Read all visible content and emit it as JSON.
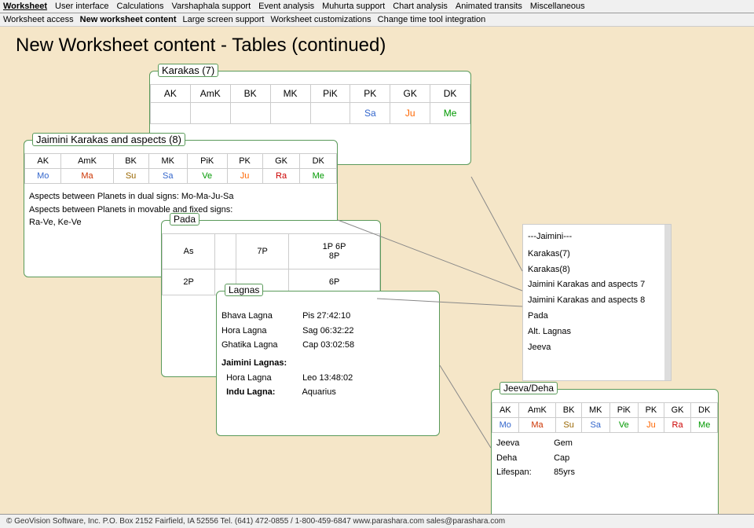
{
  "menu": {
    "items": [
      {
        "label": "Worksheet",
        "active": true
      },
      {
        "label": "User interface"
      },
      {
        "label": "Calculations"
      },
      {
        "label": "Varshaphala support"
      },
      {
        "label": "Event analysis"
      },
      {
        "label": "Muhurta support"
      },
      {
        "label": "Chart analysis"
      },
      {
        "label": "Animated transits"
      },
      {
        "label": "Miscellaneous"
      }
    ]
  },
  "submenu": {
    "items": [
      {
        "label": "Worksheet access"
      },
      {
        "label": "New worksheet content",
        "active": true
      },
      {
        "label": "Large screen support"
      },
      {
        "label": "Worksheet customizations"
      },
      {
        "label": "Change time tool integration"
      }
    ]
  },
  "page_title": "New Worksheet content - Tables (continued)",
  "karakas7": {
    "title": "Karakas (7)",
    "headers": [
      "AK",
      "AmK",
      "BK",
      "MK",
      "PiK",
      "PK",
      "GK",
      "DK"
    ],
    "row2": [
      "",
      "",
      "",
      "",
      "",
      "Sa",
      "Ju",
      "Me"
    ]
  },
  "jaimini8": {
    "title": "Jaimini Karakas and aspects (8)",
    "headers": [
      "AK",
      "AmK",
      "BK",
      "MK",
      "PiK",
      "PK",
      "GK",
      "DK"
    ],
    "row2": [
      "Mo",
      "Ma",
      "Su",
      "Sa",
      "Ve",
      "Ju",
      "Ra",
      "Me"
    ],
    "aspects1": "Aspects between Planets in dual signs: Mo-Ma-Ju-Sa",
    "aspects2": "Aspects between Planets in movable and fixed signs:",
    "aspects3": "Ra-Ve, Ke-Ve"
  },
  "pada": {
    "title": "Pada",
    "rows": [
      [
        "As",
        "",
        "7P",
        "1P 6P\n8P"
      ],
      [
        "2P",
        "",
        "",
        "6P"
      ]
    ]
  },
  "lagnas": {
    "title": "Lagnas",
    "items": [
      {
        "name": "Bhava Lagna",
        "value": "Pis 27:42:10"
      },
      {
        "name": "Hora Lagna",
        "value": "Sag 06:32:22"
      },
      {
        "name": "Ghatika Lagna",
        "value": "Cap 03:02:58"
      }
    ],
    "jaimini_label": "Jaimini Lagnas:",
    "jaimini_items": [
      {
        "name": "Hora Lagna",
        "value": "Leo 13:48:02"
      },
      {
        "name": "Indu Lagna:",
        "value": "Aquarius"
      }
    ]
  },
  "side_list": {
    "header": "---Jaimini---",
    "items": [
      "Karakas(7)",
      "Karakas(8)",
      "Jaimini Karakas and aspects 7",
      "Jaimini Karakas and aspects 8",
      "Pada",
      "Alt. Lagnas",
      "Jeeva"
    ]
  },
  "jeeva": {
    "title": "Jeeva/Deha",
    "headers": [
      "AK",
      "AmK",
      "BK",
      "MK",
      "PiK",
      "PK",
      "GK",
      "DK"
    ],
    "row2": [
      "Mo",
      "Ma",
      "Su",
      "Sa",
      "Ve",
      "Ju",
      "Ra",
      "Me"
    ],
    "bottom": [
      {
        "name": "Jeeva",
        "value": "Gem"
      },
      {
        "name": "Deha",
        "value": "Cap"
      },
      {
        "name": "Lifespan:",
        "value": "85yrs"
      }
    ]
  },
  "footer": {
    "text": "© GeoVision Software, Inc. P.O. Box 2152 Fairfield, IA 52556    Tel. (641) 472-0855 / 1-800-459-6847    www.parashara.com    sales@parashara.com"
  }
}
